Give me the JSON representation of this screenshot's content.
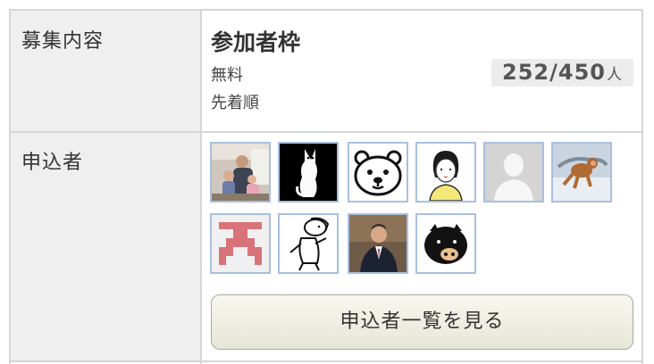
{
  "rows": {
    "recruit": {
      "label": "募集内容"
    },
    "applicants": {
      "label": "申込者"
    }
  },
  "capacity": {
    "title": "参加者枠",
    "fee": "無料",
    "method": "先着順",
    "count": "252/450",
    "unit": "人"
  },
  "applicants_list": [
    {
      "icon": "family-photo-icon"
    },
    {
      "icon": "white-cat-icon"
    },
    {
      "icon": "bear-face-icon"
    },
    {
      "icon": "girl-illustration-icon"
    },
    {
      "icon": "default-user-icon"
    },
    {
      "icon": "monkey-photo-icon"
    },
    {
      "icon": "pink-pattern-icon"
    },
    {
      "icon": "cartoon-boy-icon"
    },
    {
      "icon": "man-in-suit-photo-icon"
    },
    {
      "icon": "pig-bank-icon"
    }
  ],
  "view_list_button": {
    "label": "申込者一覧を見る"
  },
  "colors": {
    "label_bg": "#efefef",
    "border": "#d6d6d6",
    "avatar_border": "#a9bfe0",
    "badge_bg": "#ececec"
  }
}
